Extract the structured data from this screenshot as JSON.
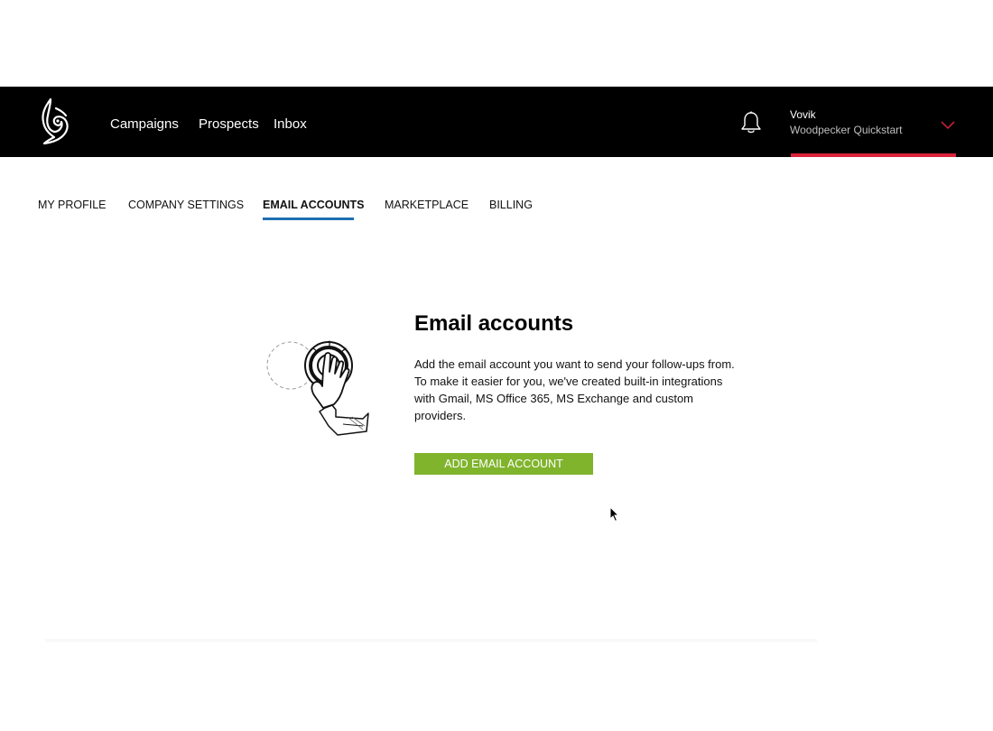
{
  "nav": {
    "items": [
      {
        "label": "Campaigns"
      },
      {
        "label": "Prospects"
      },
      {
        "label": "Inbox"
      }
    ],
    "logo_icon": "woodpecker-logo-icon",
    "notifications_icon": "bell-icon"
  },
  "user": {
    "name": "Vovik",
    "workspace": "Woodpecker Quickstart",
    "menu_icon": "chevron-down-icon",
    "accent_color": "#d9233a"
  },
  "tabs": [
    {
      "label": "MY PROFILE",
      "active": false
    },
    {
      "label": "COMPANY SETTINGS",
      "active": false
    },
    {
      "label": "EMAIL ACCOUNTS",
      "active": true
    },
    {
      "label": "MARKETPLACE",
      "active": false
    },
    {
      "label": "BILLING",
      "active": false
    }
  ],
  "tab_active_color": "#1f6fb2",
  "content": {
    "title": "Email accounts",
    "description": "Add the email account you want to send your follow-ups from. To make it easier for you, we've created built-in integrations with Gmail, MS Office 365, MS Exchange and custom providers.",
    "add_button_label": "ADD EMAIL ACCOUNT",
    "button_color": "#80b42d",
    "illustration_icon": "hand-pressing-button-icon"
  }
}
